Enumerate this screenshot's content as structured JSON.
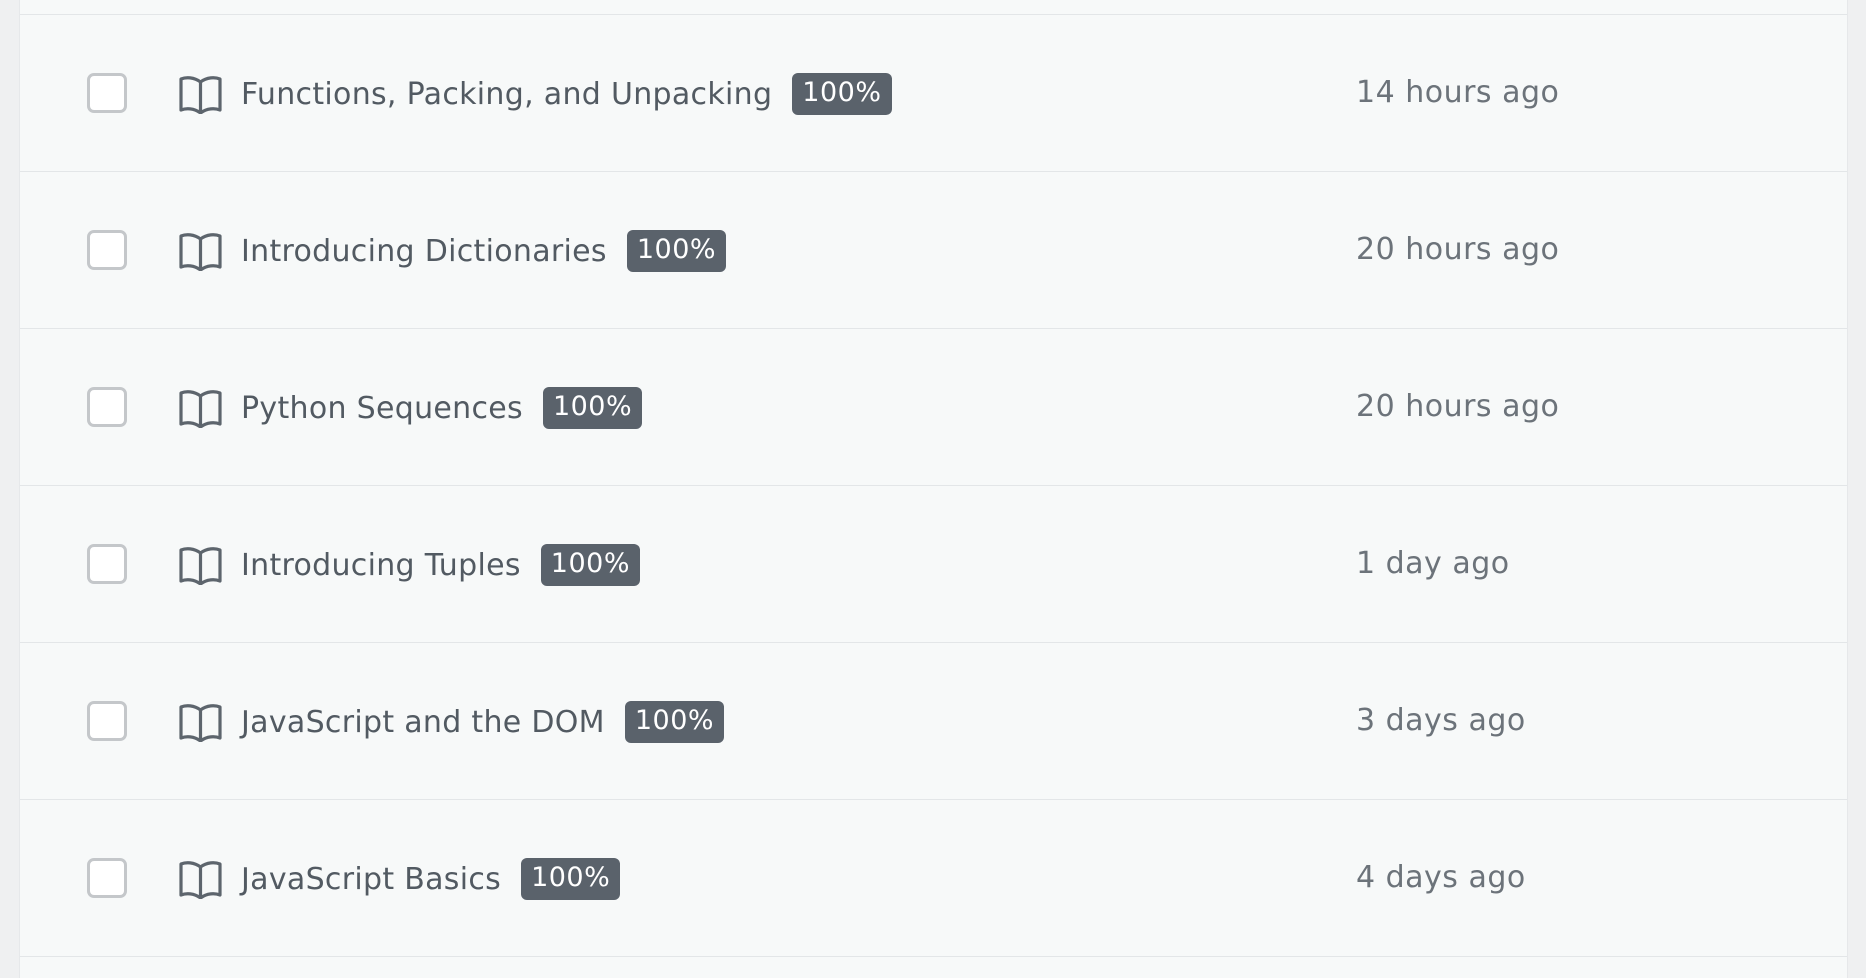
{
  "items": [
    {
      "title": "Functions, Packing, and Unpacking",
      "progress": "100%",
      "updated": "14 hours ago",
      "icon": "book-icon"
    },
    {
      "title": "Introducing Dictionaries",
      "progress": "100%",
      "updated": "20 hours ago",
      "icon": "book-icon"
    },
    {
      "title": "Python Sequences",
      "progress": "100%",
      "updated": "20 hours ago",
      "icon": "book-icon"
    },
    {
      "title": "Introducing Tuples",
      "progress": "100%",
      "updated": "1 day ago",
      "icon": "book-icon"
    },
    {
      "title": "JavaScript and the DOM",
      "progress": "100%",
      "updated": "3 days ago",
      "icon": "book-icon"
    },
    {
      "title": "JavaScript Basics",
      "progress": "100%",
      "updated": "4 days ago",
      "icon": "book-icon"
    }
  ],
  "colors": {
    "badge_background": "#5a626b",
    "title_text": "#525a62",
    "time_text": "#6c737a",
    "row_background": "#f7f9f9"
  }
}
